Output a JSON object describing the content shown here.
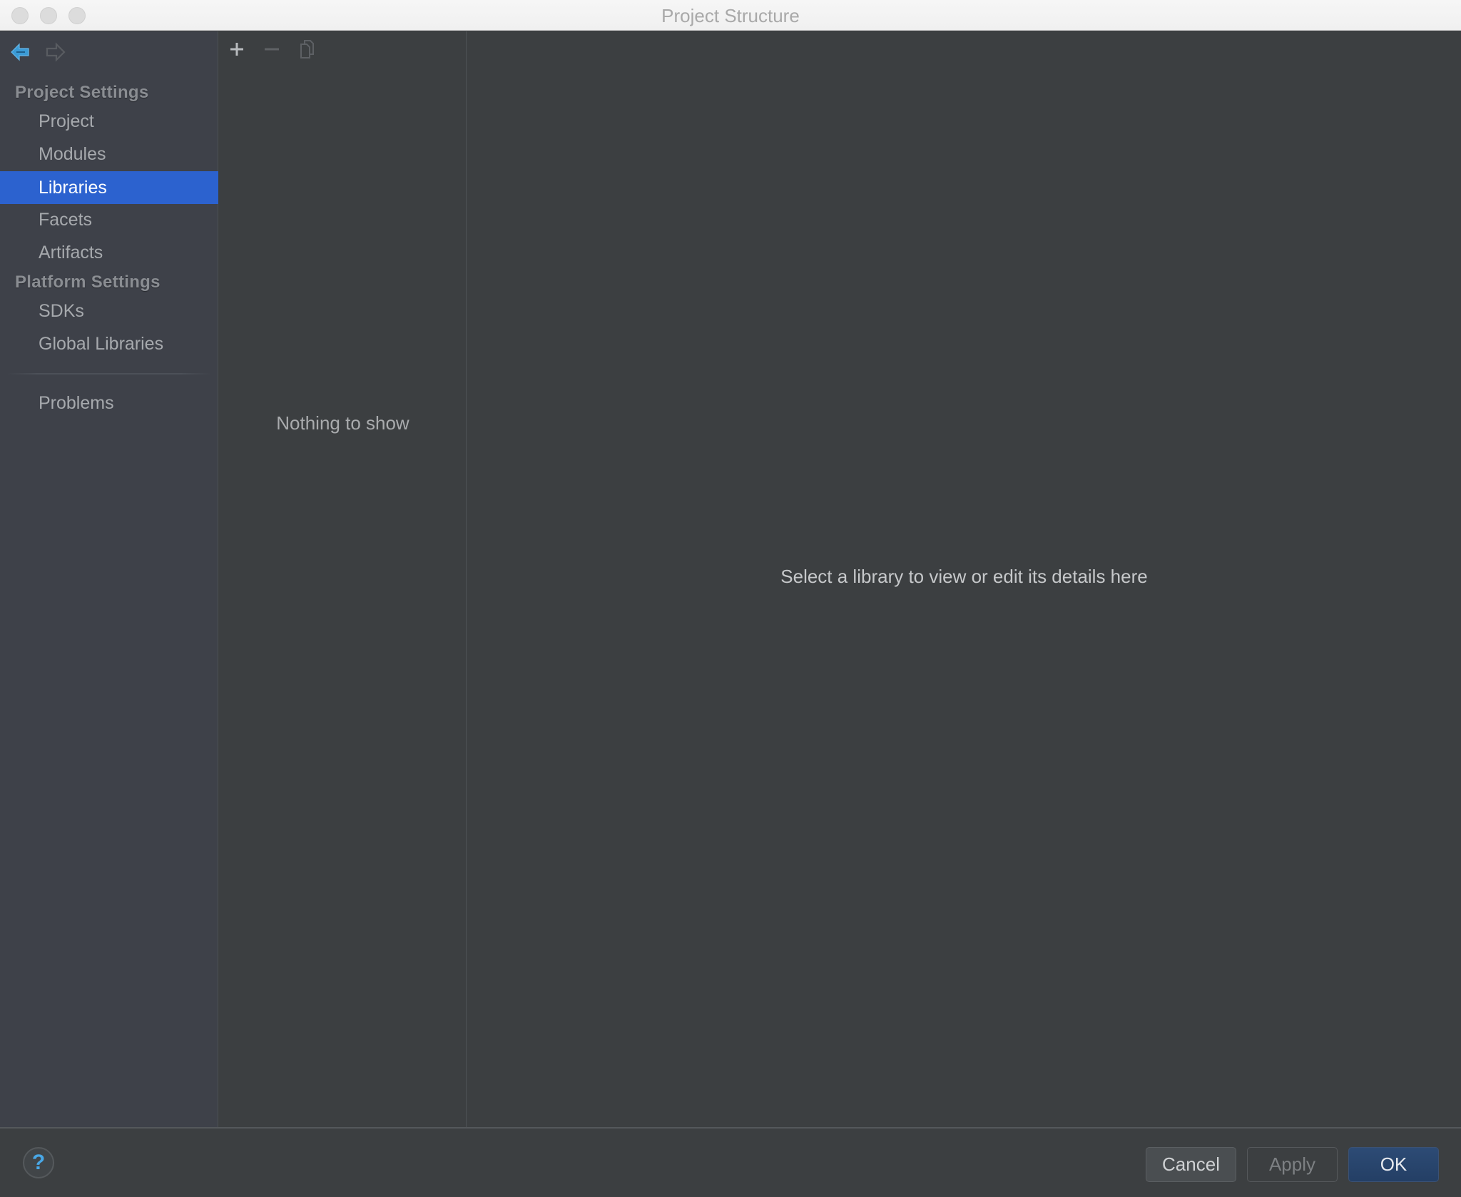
{
  "window": {
    "title": "Project Structure",
    "traffic_lights": [
      "close",
      "minimize",
      "zoom"
    ]
  },
  "sidebar": {
    "nav": {
      "back_icon": "arrow-left-icon",
      "forward_icon": "arrow-right-icon"
    },
    "groups": [
      {
        "header": "Project Settings",
        "items": [
          {
            "label": "Project",
            "selected": false
          },
          {
            "label": "Modules",
            "selected": false
          },
          {
            "label": "Libraries",
            "selected": true
          },
          {
            "label": "Facets",
            "selected": false
          },
          {
            "label": "Artifacts",
            "selected": false
          }
        ]
      },
      {
        "header": "Platform Settings",
        "items": [
          {
            "label": "SDKs",
            "selected": false
          },
          {
            "label": "Global Libraries",
            "selected": false
          }
        ]
      }
    ],
    "footer_items": [
      {
        "label": "Problems",
        "selected": false
      }
    ]
  },
  "list_panel": {
    "toolbar": {
      "add_icon": "plus-icon",
      "remove_icon": "minus-icon",
      "copy_icon": "copy-icon"
    },
    "empty_text": "Nothing to show"
  },
  "details_panel": {
    "placeholder_text": "Select a library to view or edit its details here"
  },
  "footer": {
    "help_label": "?",
    "cancel_label": "Cancel",
    "apply_label": "Apply",
    "ok_label": "OK"
  },
  "colors": {
    "selection": "#2c62cf",
    "accent_blue": "#3d9fd8",
    "ok_button": "#2a4870"
  }
}
